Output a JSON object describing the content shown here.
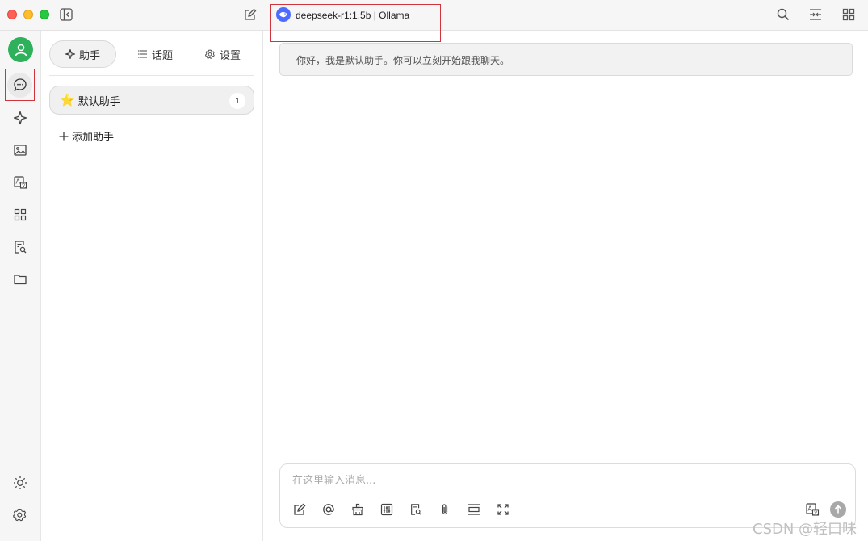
{
  "titlebar": {
    "model_label": "deepseek-r1:1.5b | Ollama",
    "icons": [
      "sidebar-toggle-icon",
      "new-chat-edit-icon",
      "search-icon",
      "split-view-icon",
      "apps-grid-icon"
    ]
  },
  "rail": {
    "items": [
      "avatar",
      "chat-icon",
      "sparkle-icon",
      "image-icon",
      "translate-icon",
      "apps-icon",
      "file-search-icon",
      "folder-icon"
    ],
    "bottom": [
      "theme-sun-icon",
      "settings-gear-icon"
    ]
  },
  "panel": {
    "tabs": [
      {
        "label": "助手",
        "icon": "sparkle-icon"
      },
      {
        "label": "话题",
        "icon": "list-icon"
      },
      {
        "label": "设置",
        "icon": "gear-icon"
      }
    ],
    "assistant": {
      "icon": "⭐",
      "name": "默认助手",
      "count": "1"
    },
    "add_label": "添加助手"
  },
  "chat": {
    "welcome": "你好，我是默认助手。你可以立刻开始跟我聊天。",
    "input_placeholder": "在这里输入消息...",
    "tools": [
      "edit-icon",
      "mention-at-icon",
      "clear-broom-icon",
      "settings-sliders-icon",
      "knowledge-search-icon",
      "attach-clip-icon",
      "expand-context-icon",
      "fullscreen-icon",
      "translate-icon"
    ]
  },
  "watermark": "CSDN @轻口味",
  "colors": {
    "accent_green": "#2fb15c",
    "model_logo": "#4d6bfe",
    "highlight_border": "#d0343c"
  }
}
